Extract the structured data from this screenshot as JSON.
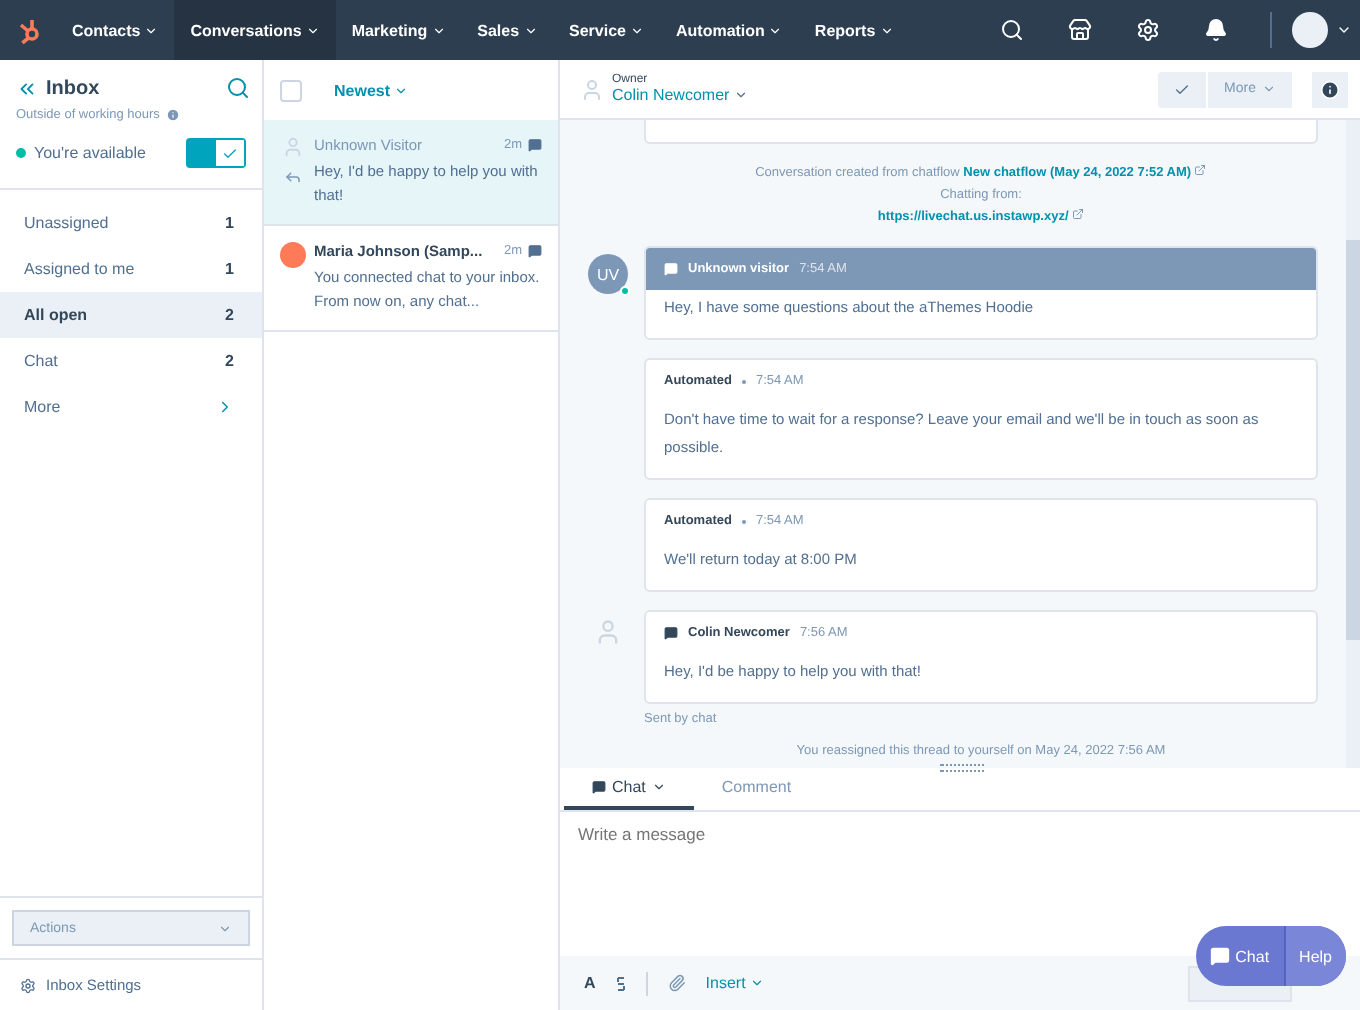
{
  "nav": {
    "items": [
      {
        "label": "Contacts",
        "selected": false
      },
      {
        "label": "Conversations",
        "selected": true
      },
      {
        "label": "Marketing",
        "selected": false
      },
      {
        "label": "Sales",
        "selected": false
      },
      {
        "label": "Service",
        "selected": false
      },
      {
        "label": "Automation",
        "selected": false
      },
      {
        "label": "Reports",
        "selected": false
      }
    ]
  },
  "sidebar": {
    "title": "Inbox",
    "working_hours": "Outside of working hours",
    "availability": {
      "label": "You're available",
      "on": true
    },
    "items": [
      {
        "label": "Unassigned",
        "count": "1",
        "selected": false,
        "kind": "count"
      },
      {
        "label": "Assigned to me",
        "count": "1",
        "selected": false,
        "kind": "count"
      },
      {
        "label": "All open",
        "count": "2",
        "selected": true,
        "kind": "count"
      },
      {
        "label": "Chat",
        "count": "2",
        "selected": false,
        "kind": "count"
      },
      {
        "label": "More",
        "selected": false,
        "kind": "more"
      }
    ],
    "actions": "Actions",
    "settings": "Inbox Settings"
  },
  "list": {
    "sort": "Newest",
    "checked": false,
    "conversations": [
      {
        "name": "Unknown Visitor",
        "time": "2m",
        "preview": "Hey, I'd be happy to help you with that!",
        "selected": true,
        "unread": false,
        "kind": "person",
        "replied": true
      },
      {
        "name": "Maria Johnson (Samp...",
        "time": "2m",
        "preview": "You connected chat to your inbox. From now on, any chat...",
        "selected": false,
        "unread": true,
        "kind": "brand",
        "replied": false
      }
    ]
  },
  "thread": {
    "owner_label": "Owner",
    "owner": "Colin Newcomer",
    "more": "More",
    "created": {
      "text": "Conversation created from chatflow",
      "link": "New chatflow (May 24, 2022 7:52 AM)",
      "chatting_from": "Chatting from:",
      "url": "https://livechat.us.instawp.xyz/"
    },
    "messages": [
      {
        "kind": "visitor",
        "initials": "UV",
        "sender": "Unknown visitor",
        "time": "7:54 AM",
        "body": "Hey, I have some questions about the aThemes Hoodie"
      },
      {
        "kind": "automated",
        "sender": "Automated",
        "time": "7:54 AM",
        "body": "Don't have time to wait for a response? Leave your email and we'll be in touch as soon as possible."
      },
      {
        "kind": "automated",
        "sender": "Automated",
        "time": "7:54 AM",
        "body": "We'll return today at 8:00 PM"
      },
      {
        "kind": "agent",
        "sender": "Colin Newcomer",
        "time": "7:56 AM",
        "body": "Hey, I'd be happy to help you with that!",
        "footer": "Sent by chat"
      }
    ],
    "event": "You reassigned this thread to yourself on May 24, 2022 7:56 AM"
  },
  "composer": {
    "tabs": [
      {
        "label": "Chat",
        "selected": true
      },
      {
        "label": "Comment",
        "selected": false
      }
    ],
    "placeholder": "Write a message",
    "format": "A",
    "insert": "Insert"
  },
  "help_widget": {
    "chat": "Chat",
    "help": "Help"
  }
}
